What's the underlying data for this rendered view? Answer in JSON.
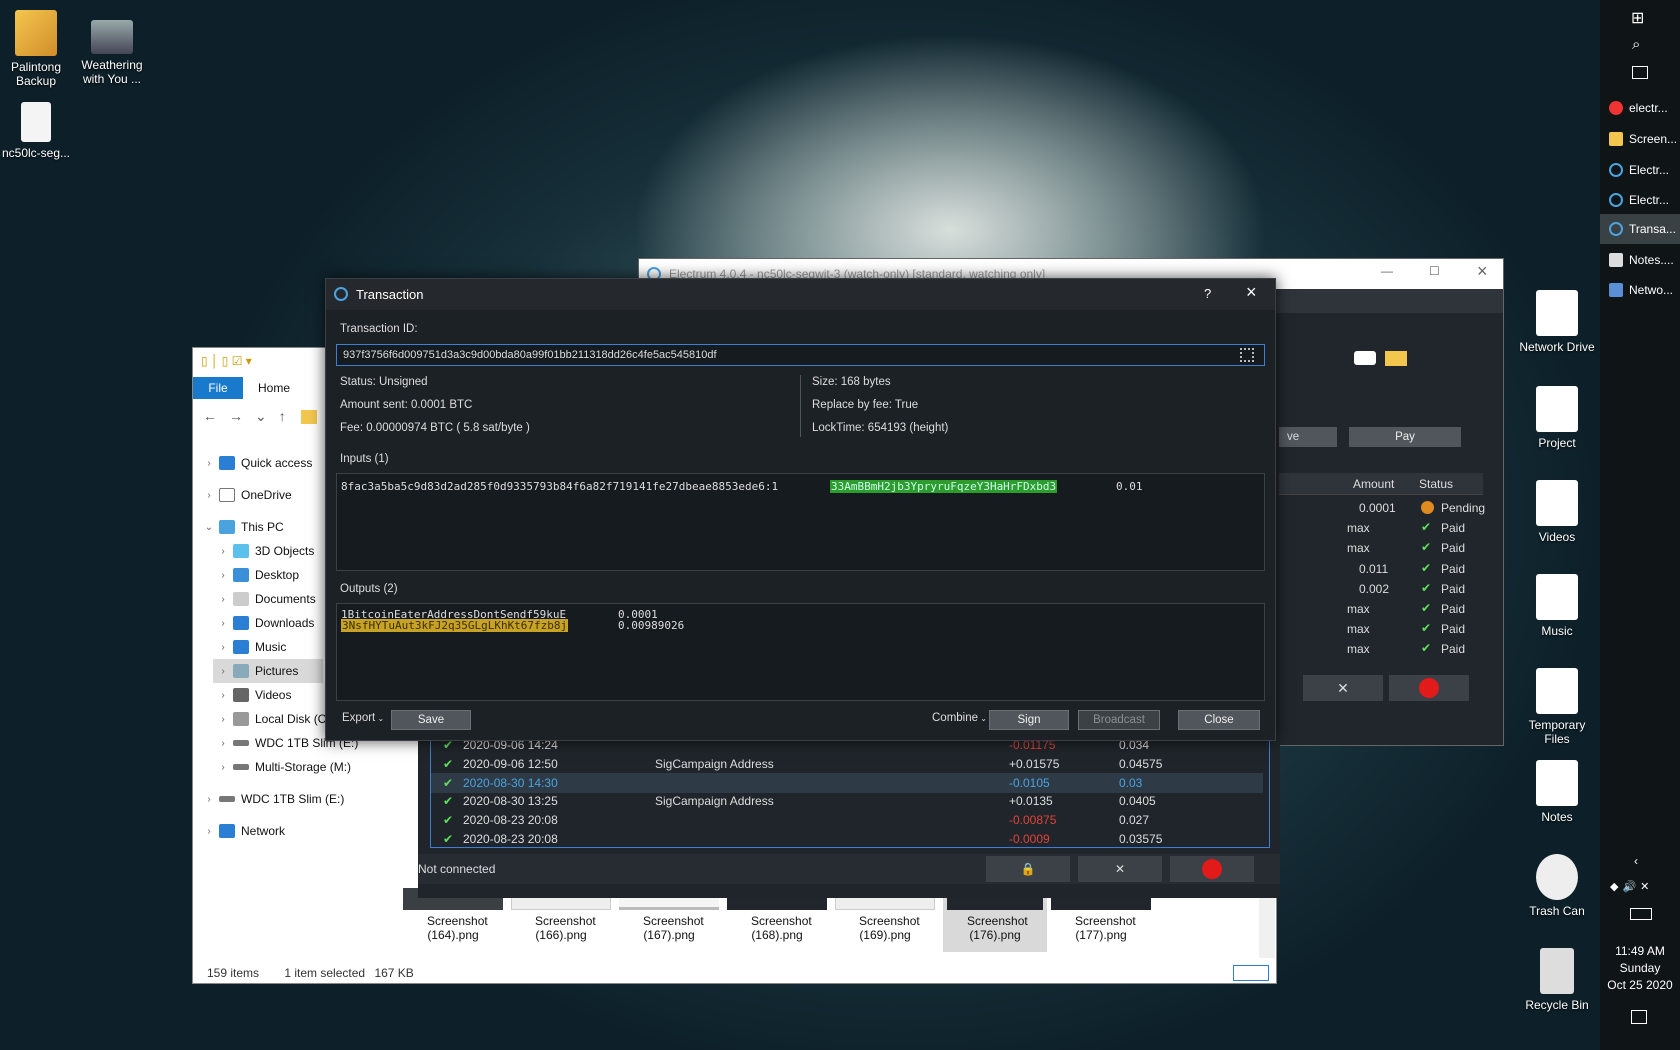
{
  "desktop_icons": [
    {
      "label": "Palintong Backup",
      "icon": "folder-icon"
    },
    {
      "label": "Weathering with You ...",
      "icon": "video-file-icon"
    },
    {
      "label": "nc50lc-seg...",
      "icon": "file-icon"
    }
  ],
  "right_icons": [
    {
      "label": "Network Drive",
      "icon": "network-drive-icon"
    },
    {
      "label": "Project",
      "icon": "project-icon"
    },
    {
      "label": "Videos",
      "icon": "videos-icon"
    },
    {
      "label": "Music",
      "icon": "music-icon"
    },
    {
      "label": "Temporary Files",
      "icon": "temporary-files-icon"
    },
    {
      "label": "Notes",
      "icon": "notes-icon"
    },
    {
      "label": "Trash Can",
      "icon": "trash-can-icon"
    },
    {
      "label": "Recycle Bin",
      "icon": "recycle-bin-icon"
    }
  ],
  "taskbar": {
    "apps": [
      "electr...",
      "Screen...",
      "Electr...",
      "Electr...",
      "Transa...",
      "Notes....",
      "Netwo..."
    ],
    "time": "11:49 AM",
    "day": "Sunday",
    "date": "Oct 25 2020"
  },
  "explorer": {
    "tabs": [
      "File",
      "Home"
    ],
    "nav": [
      "Quick access",
      "OneDrive",
      "This PC",
      "3D Objects",
      "Desktop",
      "Documents",
      "Downloads",
      "Music",
      "Pictures",
      "Videos",
      "Local Disk (C:)",
      "WDC 1TB Slim (E:)",
      "Multi-Storage (M:)",
      "WDC 1TB Slim (E:)",
      "Network"
    ],
    "files": [
      "Screenshot (164).png",
      "Screenshot (166).png",
      "Screenshot (167).png",
      "Screenshot (168).png",
      "Screenshot (169).png",
      "Screenshot (176).png",
      "Screenshot (177).png"
    ],
    "status": {
      "items": "159 items",
      "selected": "1 item selected",
      "size": "167 KB"
    }
  },
  "electrum": {
    "title": "Electrum 4.0.4  -  nc50lc-segwit-3  (watch-only)  [standard, watching only]",
    "pay_label": "Pay",
    "save_partial": "ve",
    "table_headers": [
      "Amount",
      "Status"
    ],
    "rows": [
      {
        "amount": "0.0001",
        "status": "Pending"
      },
      {
        "amount": "max",
        "status": "Paid"
      },
      {
        "amount": "max",
        "status": "Paid"
      },
      {
        "amount": "0.011",
        "status": "Paid"
      },
      {
        "amount": "0.002",
        "status": "Paid"
      },
      {
        "amount": "max",
        "status": "Paid"
      },
      {
        "amount": "max",
        "status": "Paid"
      },
      {
        "amount": "max",
        "status": "Paid"
      }
    ]
  },
  "history": {
    "rows": [
      {
        "date": "2020-09-06 14:24",
        "label": "",
        "amount": "-0.01175",
        "balance": "0.034",
        "neg": true,
        "sel": false
      },
      {
        "date": "2020-09-06 12:50",
        "label": "SigCampaign Address",
        "amount": "+0.01575",
        "balance": "0.04575",
        "neg": false,
        "sel": false
      },
      {
        "date": "2020-08-30 14:30",
        "label": "",
        "amount": "-0.0105",
        "balance": "0.03",
        "neg": true,
        "sel": true
      },
      {
        "date": "2020-08-30 13:25",
        "label": "SigCampaign Address",
        "amount": "+0.0135",
        "balance": "0.0405",
        "neg": false,
        "sel": false
      },
      {
        "date": "2020-08-23 20:08",
        "label": "",
        "amount": "-0.00875",
        "balance": "0.027",
        "neg": true,
        "sel": false
      },
      {
        "date": "2020-08-23 20:08",
        "label": "",
        "amount": "-0.0009",
        "balance": "0.03575",
        "neg": true,
        "sel": false
      }
    ],
    "status": "Not connected"
  },
  "dialog": {
    "title": "Transaction",
    "help": "?",
    "txid_label": "Transaction ID:",
    "txid": "937f3756f6d009751d3a3c9d00bda80a99f01bb211318dd26c4fe5ac545810df",
    "status": "Status: Unsigned",
    "amount_sent": "Amount sent: 0.0001 BTC",
    "fee": "Fee: 0.00000974 BTC  ( 5.8 sat/byte )",
    "size": "Size: 168 bytes",
    "rbf": "Replace by fee: True",
    "locktime": "LockTime: 654193 (height)",
    "inputs_label": "Inputs (1)",
    "input": {
      "outpoint": "8fac3a5ba5c9d83d2ad285f0d9335793b84f6a82f719141fe27dbeae8853ede6:1",
      "address": "33AmBBmH2jb3YpryruFqzeY3HaHrFDxbd3",
      "amount": "0.01"
    },
    "outputs_label": "Outputs (2)",
    "outputs": [
      {
        "address": "1BitcoinEaterAddressDontSendf59kuE",
        "amount": "0.0001"
      },
      {
        "address": "3NsfHYTuAut3kFJ2q35GLgLKhKt67fzb8j",
        "amount": "0.00989026"
      }
    ],
    "buttons": {
      "export": "Export",
      "save": "Save",
      "combine": "Combine",
      "sign": "Sign",
      "broadcast": "Broadcast",
      "close": "Close"
    }
  }
}
